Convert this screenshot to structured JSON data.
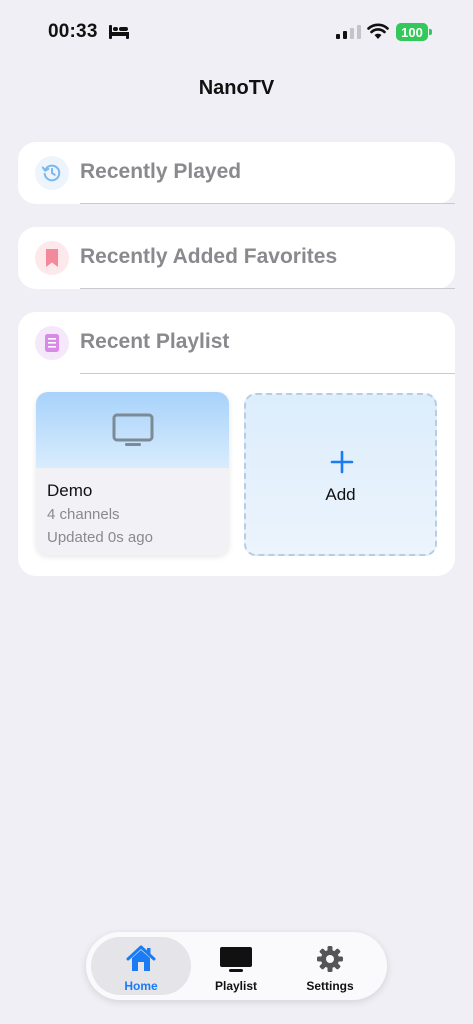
{
  "status_bar": {
    "time": "00:33",
    "battery": "100"
  },
  "app": {
    "title": "NanoTV"
  },
  "sections": {
    "recently_played": {
      "title": "Recently Played",
      "icon": "history-icon"
    },
    "recently_added_favorites": {
      "title": "Recently Added Favorites",
      "icon": "bookmark-icon"
    },
    "recent_playlist": {
      "title": "Recent Playlist",
      "icon": "list-icon"
    }
  },
  "playlists": [
    {
      "name": "Demo",
      "channels": "4 channels",
      "updated": "Updated 0s ago",
      "icon": "tv-icon"
    }
  ],
  "add_card": {
    "label": "Add",
    "icon": "plus-icon"
  },
  "tabs": [
    {
      "label": "Home",
      "icon": "home-icon",
      "active": true
    },
    {
      "label": "Playlist",
      "icon": "tv-icon",
      "active": false
    },
    {
      "label": "Settings",
      "icon": "gear-icon",
      "active": false
    }
  ],
  "colors": {
    "accent": "#1a7cf5",
    "battery": "#34c759",
    "background": "#f0eff5"
  }
}
